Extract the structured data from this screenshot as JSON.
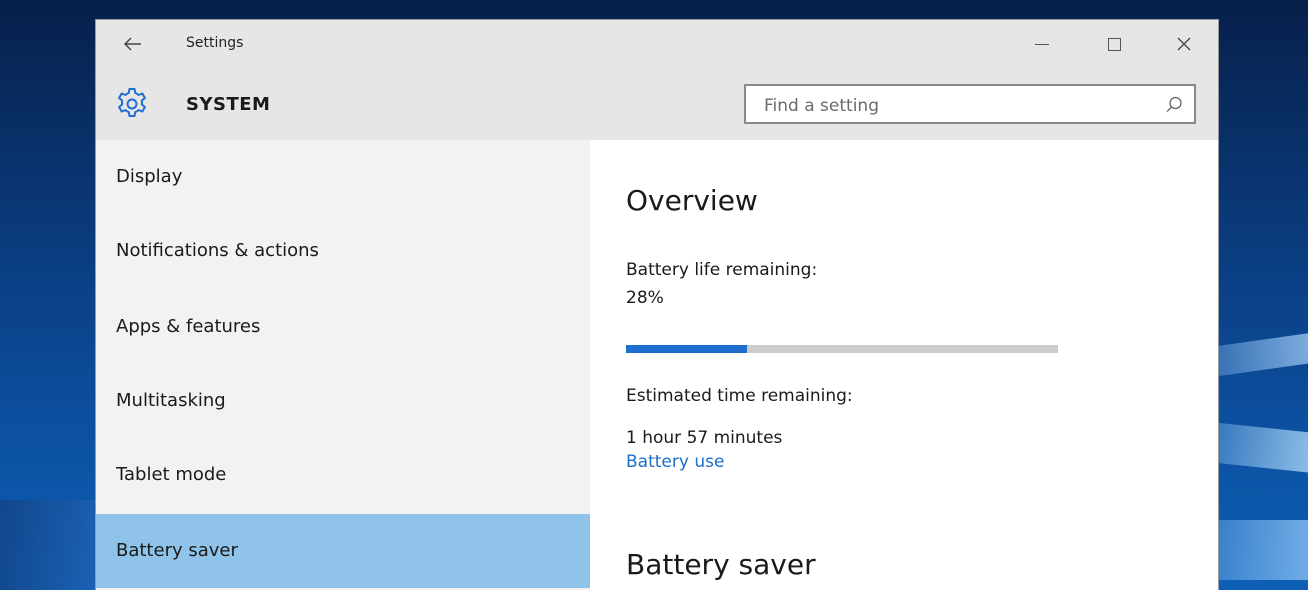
{
  "window": {
    "title": "Settings"
  },
  "header": {
    "section_title": "SYSTEM",
    "search_placeholder": "Find a setting"
  },
  "sidebar": {
    "items": [
      {
        "label": "Display",
        "selected": false
      },
      {
        "label": "Notifications & actions",
        "selected": false
      },
      {
        "label": "Apps & features",
        "selected": false
      },
      {
        "label": "Multitasking",
        "selected": false
      },
      {
        "label": "Tablet mode",
        "selected": false
      },
      {
        "label": "Battery saver",
        "selected": true
      }
    ]
  },
  "main": {
    "overview_heading": "Overview",
    "battery_life_label": "Battery life remaining:",
    "battery_percent_text": "28%",
    "battery_fraction": 0.28,
    "estimated_label": "Estimated time remaining:",
    "estimated_value": "1 hour 57 minutes",
    "battery_use_link": "Battery use",
    "battery_saver_heading": "Battery saver"
  },
  "icons": {
    "back": "back-arrow-icon",
    "settings": "gear-icon",
    "search": "search-icon",
    "minimize": "minimize-icon",
    "maximize": "maximize-icon",
    "close": "close-icon"
  },
  "colors": {
    "accent": "#1e6fd0",
    "link": "#1b6fc7",
    "selected_nav": "#8fc3ea",
    "chrome": "#e6e6e6",
    "sidebar_bg": "#f2f2f2"
  }
}
